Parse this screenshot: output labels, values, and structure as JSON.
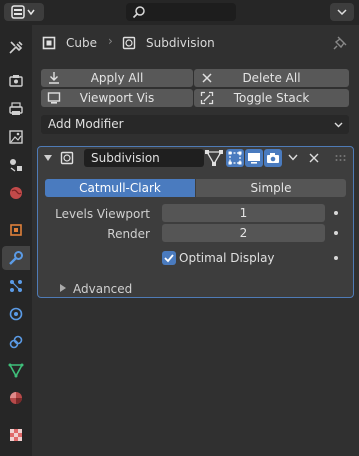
{
  "header": {
    "object_name": "Cube",
    "modifier_name": "Subdivision"
  },
  "actions": {
    "apply_all": "Apply All",
    "delete_all": "Delete All",
    "viewport_vis": "Viewport Vis",
    "toggle_stack": "Toggle Stack"
  },
  "add_modifier": {
    "label": "Add Modifier"
  },
  "modifier": {
    "name": "Subdivision",
    "algorithm": {
      "options": [
        "Catmull-Clark",
        "Simple"
      ],
      "selected": "Catmull-Clark"
    },
    "levels_viewport": {
      "label": "Levels Viewport",
      "value": "1"
    },
    "render": {
      "label": "Render",
      "value": "2"
    },
    "optimal_display": {
      "label": "Optimal Display",
      "checked": true
    },
    "advanced": {
      "label": "Advanced"
    }
  },
  "colors": {
    "accent": "#4a7bbf",
    "panel": "#3d3d3d",
    "background": "#303030"
  }
}
